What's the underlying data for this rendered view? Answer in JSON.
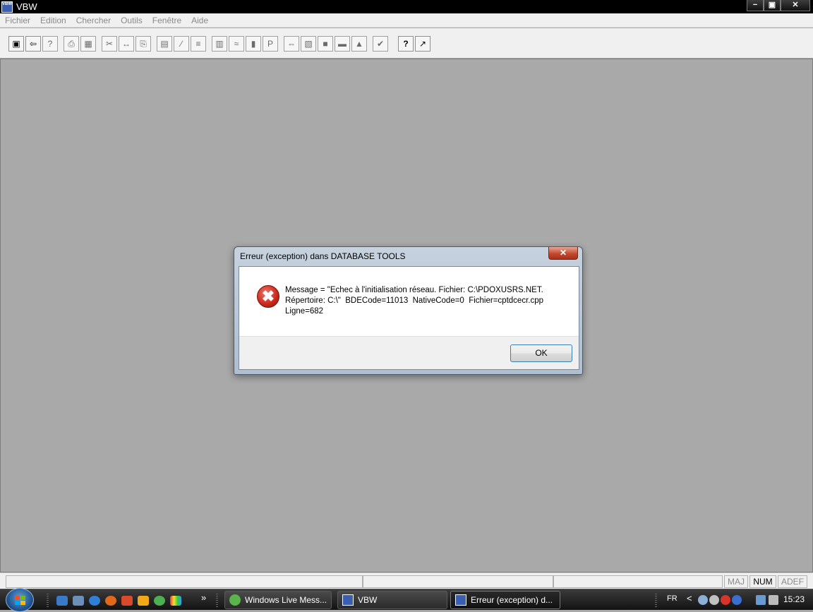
{
  "window": {
    "icon_text": "VBW",
    "title": "VBW",
    "min": "−",
    "max": "▣",
    "close": "✕"
  },
  "menu": [
    "Fichier",
    "Edition",
    "Chercher",
    "Outils",
    "Fenêtre",
    "Aide"
  ],
  "toolbar": {
    "glyphs": [
      "▣",
      "⇦",
      "?",
      "⎙",
      "▦",
      "✂",
      "↔",
      "⎘",
      "▤",
      "∕",
      "≡",
      "▥",
      "≈",
      "▮",
      "P",
      "⇔",
      "▧",
      "■",
      "▬",
      "▲",
      "✔",
      "?",
      "↗"
    ]
  },
  "statusbar": {
    "caps": "MAJ",
    "num": "NUM",
    "adef": "ADEF"
  },
  "dialog": {
    "title": "Erreur (exception) dans DATABASE TOOLS",
    "close": "✕",
    "icon": "✖",
    "message_line1": "Message = \"Echec à l'initialisation réseau. Fichier: C:\\PDOXUSRS.NET.",
    "message_line2": "Répertoire: C:\\\"  BDECode=11013  NativeCode=0  Fichier=cptdcecr.cpp",
    "message_line3": "Ligne=682",
    "ok_label": "OK"
  },
  "taskbar": {
    "chevron": "»",
    "tasks": [
      {
        "label": "Windows Live Mess..."
      },
      {
        "label": "VBW"
      },
      {
        "label": "Erreur (exception) d..."
      }
    ],
    "language": "FR",
    "tray_arrow": "<",
    "clock": "15:23"
  }
}
